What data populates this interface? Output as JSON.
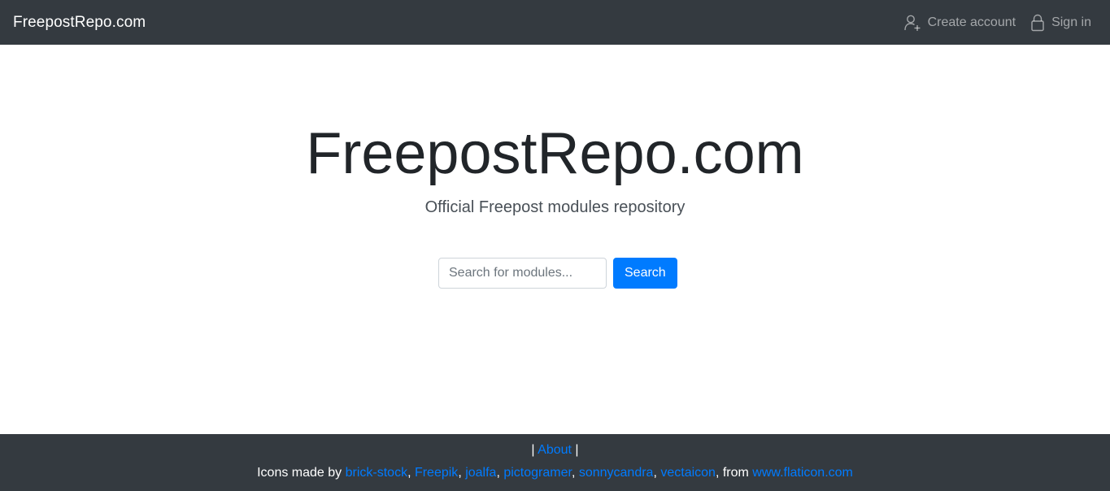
{
  "navbar": {
    "brand": "FreepostRepo.com",
    "create_account": "Create account",
    "sign_in": "Sign in"
  },
  "hero": {
    "title": "FreepostRepo.com",
    "subtitle": "Official Freepost modules repository"
  },
  "search": {
    "placeholder": "Search for modules...",
    "button_label": "Search"
  },
  "footer": {
    "sep_left": "| ",
    "about": "About",
    "sep_right": " |",
    "icons_prefix": "Icons made by ",
    "authors": [
      "brick-stock",
      "Freepik",
      "joalfa",
      "pictogramer",
      "sonnycandra",
      "vectaicon"
    ],
    "comma": ", ",
    "from_text": ", from ",
    "source": "www.flaticon.com"
  },
  "colors": {
    "navbar_bg": "#343a40",
    "primary": "#007bff"
  },
  "icons": {
    "create_account": "user-add-icon",
    "sign_in": "lock-icon"
  }
}
